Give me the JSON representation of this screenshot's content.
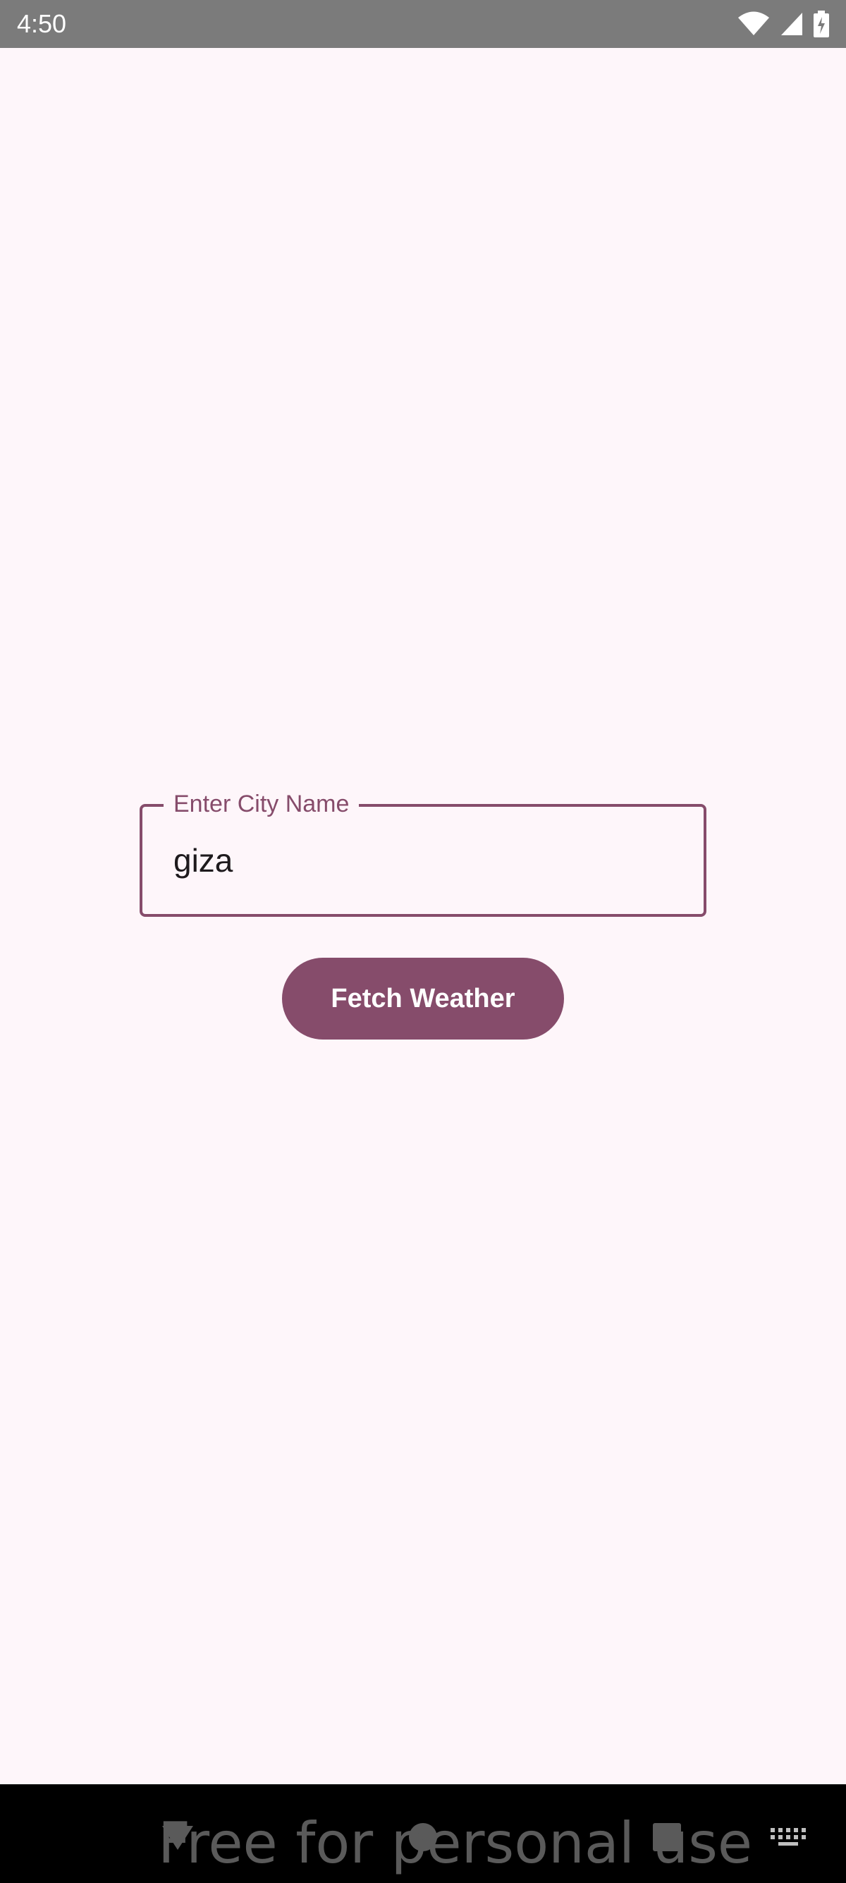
{
  "status_bar": {
    "time": "4:50",
    "icons": [
      "wifi-icon",
      "cellular-signal-icon",
      "battery-charging-icon"
    ]
  },
  "form": {
    "city_field": {
      "label": "Enter City Name",
      "value": "giza"
    },
    "fetch_button": {
      "label": "Fetch Weather"
    }
  },
  "nav_bar": {
    "buttons": [
      "back-icon",
      "home-icon",
      "recents-icon",
      "keyboard-icon"
    ],
    "watermark": "Free for personal use"
  },
  "colors": {
    "background": "#FEF6FA",
    "accent": "#864C6B",
    "status_bar": "#7B7B7B",
    "nav_bar": "#000000"
  }
}
